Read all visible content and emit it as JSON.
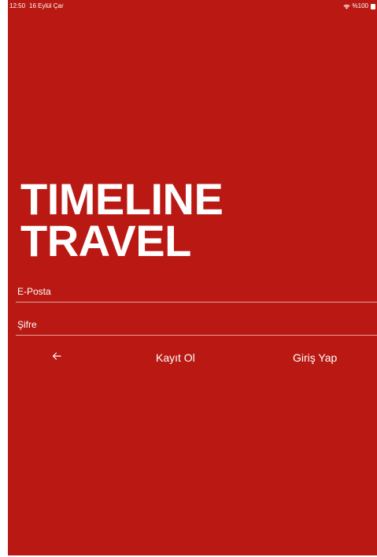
{
  "status_bar": {
    "time": "12:50",
    "date": "16 Eylül Çar",
    "battery": "%100",
    "icons": [
      "wifi-icon",
      "battery-icon"
    ]
  },
  "app": {
    "title_line1": "TIMELINE",
    "title_line2": "TRAVEL",
    "background_color": "#b91912",
    "text_color": "#ffffff"
  },
  "form": {
    "email_placeholder": "E-Posta",
    "password_placeholder": "Şifre"
  },
  "actions": {
    "back_icon": "arrow-left-icon",
    "register_label": "Kayıt Ol",
    "login_label": "Giriş Yap"
  }
}
